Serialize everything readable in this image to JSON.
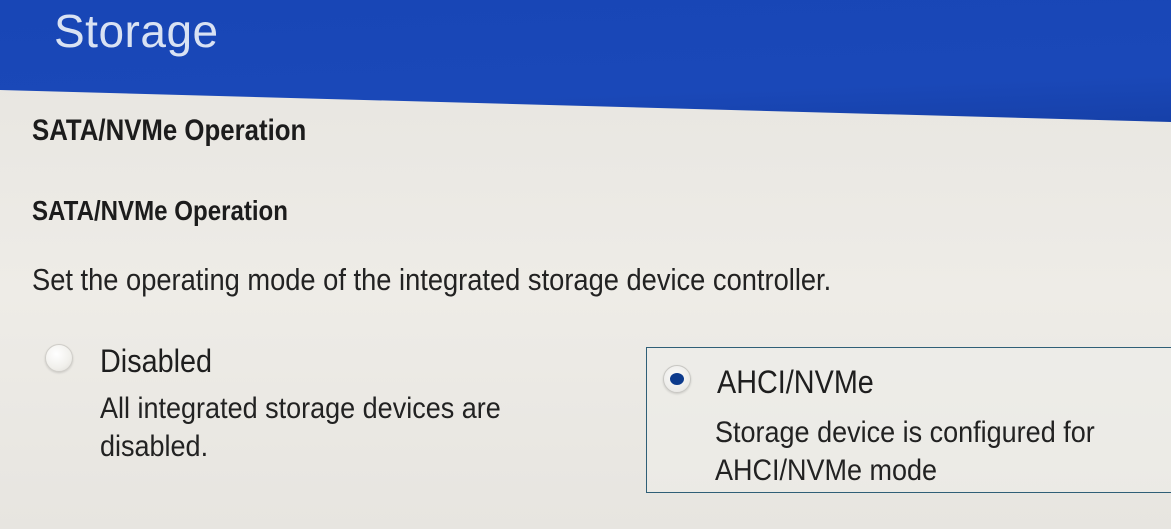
{
  "header": {
    "title": "Storage"
  },
  "section": {
    "title": "SATA/NVMe Operation"
  },
  "setting": {
    "title": "SATA/NVMe Operation",
    "description": "Set the operating mode of the integrated storage device controller.",
    "selected": "AHCI/NVMe",
    "options": [
      {
        "label": "Disabled",
        "description_line1": "All integrated storage devices are",
        "description_line2": "disabled.",
        "selected": false
      },
      {
        "label": "AHCI/NVMe",
        "description_line1": "Storage device is configured for",
        "description_line2": "AHCI/NVMe mode",
        "selected": true
      }
    ]
  },
  "colors": {
    "header_blue": "#1846b6",
    "radio_selected": "#0c3a8c",
    "focus_border": "#2f5f77"
  }
}
